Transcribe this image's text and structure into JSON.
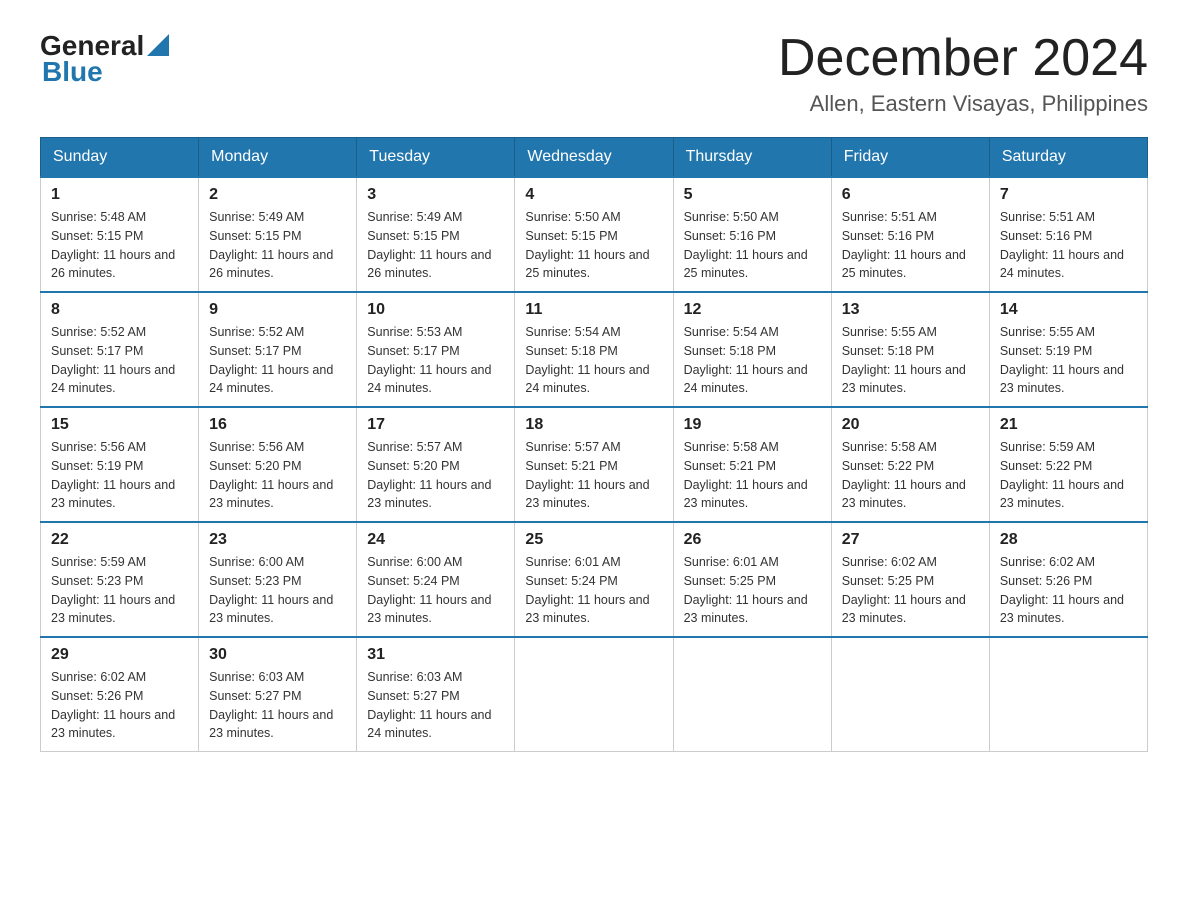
{
  "header": {
    "logo_general": "General",
    "logo_blue": "Blue",
    "title": "December 2024",
    "subtitle": "Allen, Eastern Visayas, Philippines"
  },
  "weekdays": [
    "Sunday",
    "Monday",
    "Tuesday",
    "Wednesday",
    "Thursday",
    "Friday",
    "Saturday"
  ],
  "weeks": [
    [
      {
        "day": "1",
        "sunrise": "5:48 AM",
        "sunset": "5:15 PM",
        "daylight": "11 hours and 26 minutes."
      },
      {
        "day": "2",
        "sunrise": "5:49 AM",
        "sunset": "5:15 PM",
        "daylight": "11 hours and 26 minutes."
      },
      {
        "day": "3",
        "sunrise": "5:49 AM",
        "sunset": "5:15 PM",
        "daylight": "11 hours and 26 minutes."
      },
      {
        "day": "4",
        "sunrise": "5:50 AM",
        "sunset": "5:15 PM",
        "daylight": "11 hours and 25 minutes."
      },
      {
        "day": "5",
        "sunrise": "5:50 AM",
        "sunset": "5:16 PM",
        "daylight": "11 hours and 25 minutes."
      },
      {
        "day": "6",
        "sunrise": "5:51 AM",
        "sunset": "5:16 PM",
        "daylight": "11 hours and 25 minutes."
      },
      {
        "day": "7",
        "sunrise": "5:51 AM",
        "sunset": "5:16 PM",
        "daylight": "11 hours and 24 minutes."
      }
    ],
    [
      {
        "day": "8",
        "sunrise": "5:52 AM",
        "sunset": "5:17 PM",
        "daylight": "11 hours and 24 minutes."
      },
      {
        "day": "9",
        "sunrise": "5:52 AM",
        "sunset": "5:17 PM",
        "daylight": "11 hours and 24 minutes."
      },
      {
        "day": "10",
        "sunrise": "5:53 AM",
        "sunset": "5:17 PM",
        "daylight": "11 hours and 24 minutes."
      },
      {
        "day": "11",
        "sunrise": "5:54 AM",
        "sunset": "5:18 PM",
        "daylight": "11 hours and 24 minutes."
      },
      {
        "day": "12",
        "sunrise": "5:54 AM",
        "sunset": "5:18 PM",
        "daylight": "11 hours and 24 minutes."
      },
      {
        "day": "13",
        "sunrise": "5:55 AM",
        "sunset": "5:18 PM",
        "daylight": "11 hours and 23 minutes."
      },
      {
        "day": "14",
        "sunrise": "5:55 AM",
        "sunset": "5:19 PM",
        "daylight": "11 hours and 23 minutes."
      }
    ],
    [
      {
        "day": "15",
        "sunrise": "5:56 AM",
        "sunset": "5:19 PM",
        "daylight": "11 hours and 23 minutes."
      },
      {
        "day": "16",
        "sunrise": "5:56 AM",
        "sunset": "5:20 PM",
        "daylight": "11 hours and 23 minutes."
      },
      {
        "day": "17",
        "sunrise": "5:57 AM",
        "sunset": "5:20 PM",
        "daylight": "11 hours and 23 minutes."
      },
      {
        "day": "18",
        "sunrise": "5:57 AM",
        "sunset": "5:21 PM",
        "daylight": "11 hours and 23 minutes."
      },
      {
        "day": "19",
        "sunrise": "5:58 AM",
        "sunset": "5:21 PM",
        "daylight": "11 hours and 23 minutes."
      },
      {
        "day": "20",
        "sunrise": "5:58 AM",
        "sunset": "5:22 PM",
        "daylight": "11 hours and 23 minutes."
      },
      {
        "day": "21",
        "sunrise": "5:59 AM",
        "sunset": "5:22 PM",
        "daylight": "11 hours and 23 minutes."
      }
    ],
    [
      {
        "day": "22",
        "sunrise": "5:59 AM",
        "sunset": "5:23 PM",
        "daylight": "11 hours and 23 minutes."
      },
      {
        "day": "23",
        "sunrise": "6:00 AM",
        "sunset": "5:23 PM",
        "daylight": "11 hours and 23 minutes."
      },
      {
        "day": "24",
        "sunrise": "6:00 AM",
        "sunset": "5:24 PM",
        "daylight": "11 hours and 23 minutes."
      },
      {
        "day": "25",
        "sunrise": "6:01 AM",
        "sunset": "5:24 PM",
        "daylight": "11 hours and 23 minutes."
      },
      {
        "day": "26",
        "sunrise": "6:01 AM",
        "sunset": "5:25 PM",
        "daylight": "11 hours and 23 minutes."
      },
      {
        "day": "27",
        "sunrise": "6:02 AM",
        "sunset": "5:25 PM",
        "daylight": "11 hours and 23 minutes."
      },
      {
        "day": "28",
        "sunrise": "6:02 AM",
        "sunset": "5:26 PM",
        "daylight": "11 hours and 23 minutes."
      }
    ],
    [
      {
        "day": "29",
        "sunrise": "6:02 AM",
        "sunset": "5:26 PM",
        "daylight": "11 hours and 23 minutes."
      },
      {
        "day": "30",
        "sunrise": "6:03 AM",
        "sunset": "5:27 PM",
        "daylight": "11 hours and 23 minutes."
      },
      {
        "day": "31",
        "sunrise": "6:03 AM",
        "sunset": "5:27 PM",
        "daylight": "11 hours and 24 minutes."
      },
      null,
      null,
      null,
      null
    ]
  ]
}
